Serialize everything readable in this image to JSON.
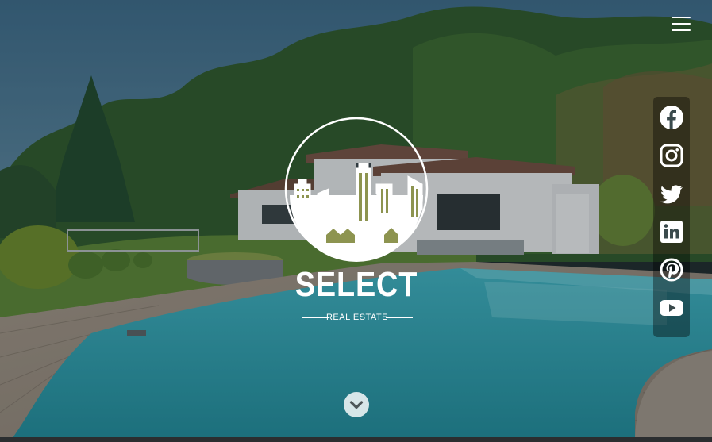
{
  "menu": {
    "icon": "hamburger-menu-icon"
  },
  "brand": {
    "name": "SELECT",
    "tagline": "REAL ESTATE",
    "emblem": "city-skyline-icon",
    "accent_color": "#8d9450"
  },
  "social": [
    {
      "network": "Facebook",
      "icon": "facebook-icon"
    },
    {
      "network": "Instagram",
      "icon": "instagram-icon"
    },
    {
      "network": "Twitter",
      "icon": "twitter-icon"
    },
    {
      "network": "LinkedIn",
      "icon": "linkedin-icon"
    },
    {
      "network": "Pinterest",
      "icon": "pinterest-icon"
    },
    {
      "network": "YouTube",
      "icon": "youtube-icon"
    }
  ],
  "scroll": {
    "icon": "chevron-down-icon"
  },
  "hero": {
    "image": "house-with-pool-photo"
  }
}
